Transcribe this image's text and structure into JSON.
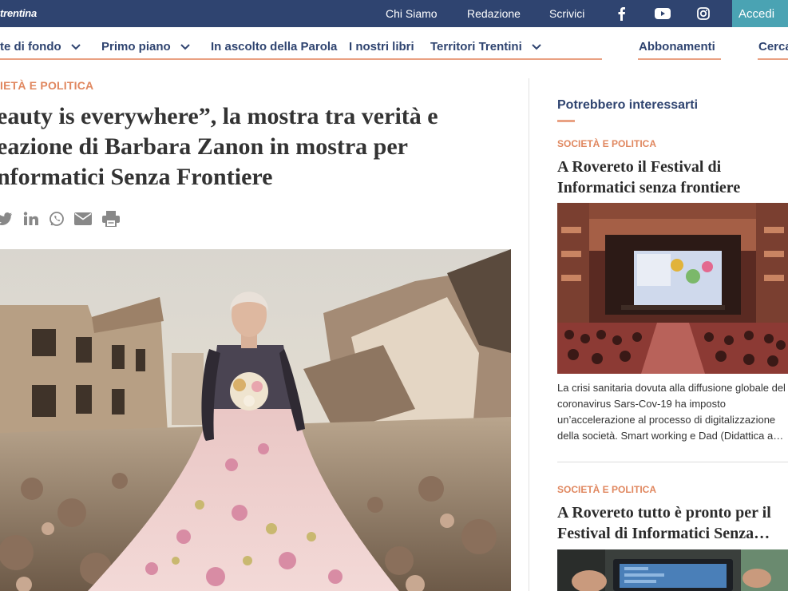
{
  "topbar": {
    "brand": "trentina",
    "links": [
      "Chi Siamo",
      "Redazione",
      "Scrivici"
    ],
    "social_icons": [
      "facebook-icon",
      "youtube-icon",
      "instagram-icon"
    ],
    "login_label": "Accedi",
    "colors": {
      "bar": "#2f4470",
      "login": "#4aa3b3"
    }
  },
  "nav": {
    "items": [
      {
        "label": "te di fondo",
        "has_dropdown": true
      },
      {
        "label": "Primo piano",
        "has_dropdown": true
      },
      {
        "label": "In ascolto della Parola",
        "has_dropdown": false
      },
      {
        "label": "I nostri libri",
        "has_dropdown": false
      },
      {
        "label": "Territori Trentini",
        "has_dropdown": true
      },
      {
        "label": "Abbonamenti",
        "has_dropdown": false
      },
      {
        "label": "Cerca",
        "has_dropdown": false
      }
    ],
    "accent": "#e9a183"
  },
  "article": {
    "category": "IETÀ E POLITICA",
    "title_lines": [
      "eauty is everywhere”, la mostra tra verità e",
      "eazione di Barbara Zanon in mostra per",
      "nformatici Senza Frontiere"
    ],
    "share_icons": [
      "twitter-icon",
      "linkedin-icon",
      "whatsapp-icon",
      "email-icon",
      "print-icon"
    ],
    "hero_image": "elderly woman in a flowered pink gown standing among building ruins"
  },
  "sidebar": {
    "title": "Potrebbero interessarti",
    "cards": [
      {
        "category": "SOCIETÀ E POLITICA",
        "title_lines": [
          "A Rovereto il Festival di",
          "Informatici senza frontiere"
        ],
        "image": "theatre audience facing a stage with a projected screen",
        "excerpt_lines": [
          "La crisi sanitaria dovuta alla diffusione globale del",
          "coronavirus Sars-Cov-19 ha imposto",
          "un’accelerazione al processo di digitalizzazione",
          "della società. Smart working e Dad (Didattica a…"
        ]
      },
      {
        "category": "SOCIETÀ E POLITICA",
        "title_lines": [
          "A Rovereto tutto è pronto per il",
          "Festival di Informatici Senza…"
        ],
        "image": "hands working on an open laptop with electronic parts"
      }
    ]
  }
}
